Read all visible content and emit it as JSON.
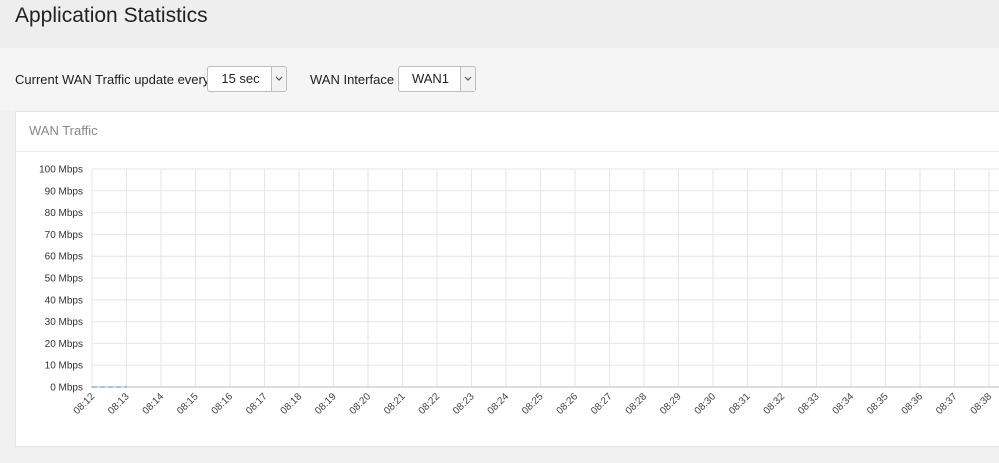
{
  "header": {
    "title": "Application Statistics"
  },
  "controls": {
    "update_label": "Current WAN Traffic update every",
    "update_value": "15 sec",
    "interface_label": "WAN Interface",
    "interface_value": "WAN1"
  },
  "panel": {
    "title": "WAN Traffic"
  },
  "colors": {
    "series_line": "#7fb8d8",
    "grid": "#e6e6e6",
    "axis": "#bbbbbb"
  },
  "chart_data": {
    "type": "line",
    "title": "",
    "xlabel": "",
    "ylabel": "",
    "ylim": [
      0,
      100
    ],
    "y_ticks": [
      "0 Mbps",
      "10 Mbps",
      "20 Mbps",
      "30 Mbps",
      "40 Mbps",
      "50 Mbps",
      "60 Mbps",
      "70 Mbps",
      "80 Mbps",
      "90 Mbps",
      "100 Mbps"
    ],
    "x": [
      "08:12",
      "08:13",
      "08:14",
      "08:15",
      "08:16",
      "08:17",
      "08:18",
      "08:19",
      "08:20",
      "08:21",
      "08:22",
      "08:23",
      "08:24",
      "08:25",
      "08:26",
      "08:27",
      "08:28",
      "08:29",
      "08:30",
      "08:31",
      "08:32",
      "08:33",
      "08:34",
      "08:35",
      "08:36",
      "08:37",
      "08:38"
    ],
    "grid": true,
    "legend": "none",
    "series": [
      {
        "x": [
          "08:12",
          "08:13"
        ],
        "values": [
          0,
          0
        ],
        "dashed": true
      }
    ]
  }
}
